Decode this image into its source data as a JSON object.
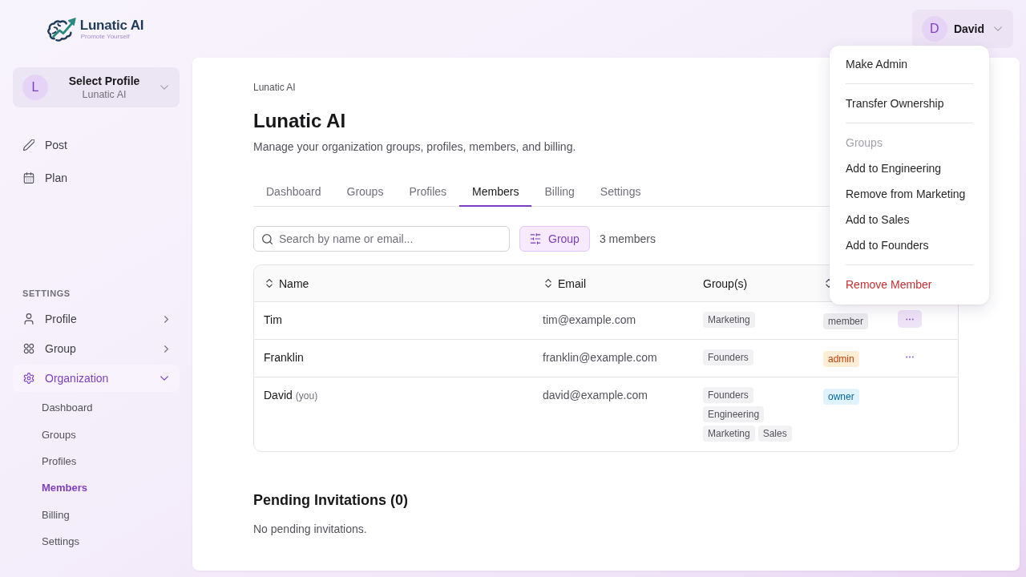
{
  "sidebar": {
    "logo": {
      "name": "Lunatic AI",
      "tagline": "Promote Yourself"
    },
    "profile_selector": {
      "avatar": "L",
      "title": "Select Profile",
      "subtitle": "Lunatic AI"
    },
    "nav_items": [
      {
        "label": "Post",
        "selected": false
      },
      {
        "label": "Plan",
        "selected": false
      }
    ],
    "settings": {
      "heading": "SETTINGS",
      "items": [
        {
          "label": "Profile",
          "expanded": false,
          "selected": false
        },
        {
          "label": "Group",
          "expanded": false,
          "selected": false
        },
        {
          "label": "Organization",
          "expanded": true,
          "selected": true,
          "children": [
            {
              "label": "Dashboard",
              "selected": false
            },
            {
              "label": "Groups",
              "selected": false
            },
            {
              "label": "Profiles",
              "selected": false
            },
            {
              "label": "Members",
              "selected": true
            },
            {
              "label": "Billing",
              "selected": false
            },
            {
              "label": "Settings",
              "selected": false
            }
          ]
        }
      ]
    }
  },
  "user_menu": {
    "avatar": "D",
    "name": "David"
  },
  "page": {
    "breadcrumb": "Lunatic AI",
    "title": "Lunatic AI",
    "description": "Manage your organization groups, profiles, members, and billing.",
    "tabs": [
      {
        "label": "Dashboard",
        "selected": false
      },
      {
        "label": "Groups",
        "selected": false
      },
      {
        "label": "Profiles",
        "selected": false
      },
      {
        "label": "Members",
        "selected": true
      },
      {
        "label": "Billing",
        "selected": false
      },
      {
        "label": "Settings",
        "selected": false
      }
    ]
  },
  "toolbar": {
    "search": {
      "placeholder": "Search by name or email..."
    },
    "filter_button": "Group",
    "member_count": "3 members"
  },
  "table": {
    "columns": [
      {
        "label": "Name",
        "sortable": true
      },
      {
        "label": "Email",
        "sortable": true
      },
      {
        "label": "Group(s)",
        "sortable": false
      },
      {
        "sortable": true
      }
    ],
    "rows": [
      {
        "name": "Tim",
        "email": "tim@example.com",
        "groups": [
          "Marketing"
        ],
        "role": {
          "label": "member",
          "kind": "neutral"
        },
        "actions": {
          "open": true
        }
      },
      {
        "name": "Franklin",
        "email": "franklin@example.com",
        "groups": [
          "Founders"
        ],
        "role": {
          "label": "admin",
          "kind": "warning"
        },
        "actions": {
          "open": false
        }
      },
      {
        "name": "David",
        "you_tag": "(you)",
        "email": "david@example.com",
        "groups": [
          "Founders",
          "Engineering",
          "Marketing",
          "Sales"
        ],
        "role": {
          "label": "owner",
          "kind": "info"
        }
      }
    ]
  },
  "pending": {
    "title": "Pending Invitations (0)",
    "empty_text": "No pending invitations."
  },
  "action_menu": {
    "sections": [
      {
        "items": [
          {
            "label": "Make Admin",
            "kind": "action"
          }
        ]
      },
      {
        "items": [
          {
            "label": "Transfer Ownership",
            "kind": "action"
          }
        ]
      },
      {
        "items": [
          {
            "label": "Groups",
            "kind": "heading"
          },
          {
            "label": "Add to Engineering",
            "kind": "action"
          },
          {
            "label": "Remove from Marketing",
            "kind": "action"
          },
          {
            "label": "Add to Sales",
            "kind": "action"
          },
          {
            "label": "Add to Founders",
            "kind": "action"
          }
        ]
      },
      {
        "items": [
          {
            "label": "Remove Member",
            "kind": "danger"
          }
        ]
      }
    ]
  }
}
